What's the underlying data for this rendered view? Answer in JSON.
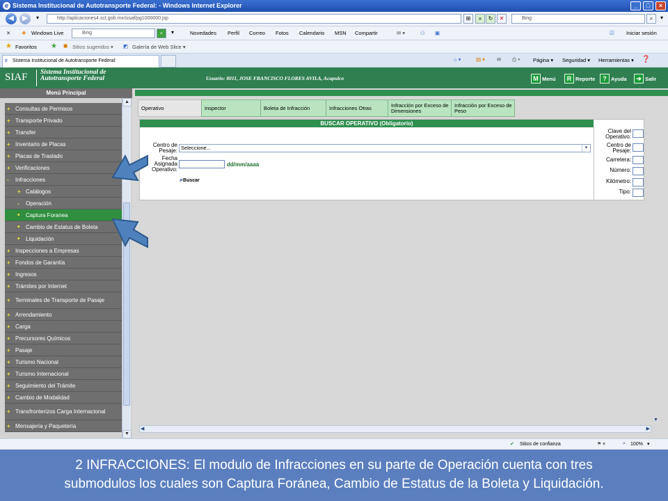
{
  "window": {
    "title": "Sistema Institucional de Autotransporte Federal: - Windows Internet Explorer",
    "controls": [
      "_",
      "□",
      "×"
    ]
  },
  "address": {
    "url": "http://aplicaciones4.sct.gob.mx/sisaf/pg1000000.jsp",
    "search_placeholder": "Bing"
  },
  "menubar": {
    "windows_live": "Windows Live",
    "search_placeholder": "Bing",
    "items": [
      "Novedades",
      "Perfil",
      "Correo",
      "Fotos",
      "Calendario",
      "MSN",
      "Compartir"
    ],
    "signin": "Iniciar sesión"
  },
  "favorites": {
    "favoritos": "Favoritos",
    "sitios": "Sitios sugeridos ▾",
    "galeria": "Galería de Web Slice ▾"
  },
  "tab": {
    "title": "Sistema Institucional de Autotransporte Federal:"
  },
  "commandbar": {
    "pagina": "Página ▾",
    "seguridad": "Seguridad ▾",
    "herramientas": "Herramientas ▾"
  },
  "app": {
    "logo": "SIAF",
    "name_line1": "Sistema Institucional de",
    "name_line2": "Autotransporte Federal",
    "user": "Usuario: 8011, JOSE FRANCISCO FLORES AVILA, Acapulco",
    "menu_btn": "Menú",
    "report_btn": "Reporte",
    "help_btn": "Ayuda",
    "exit_btn": "Salir"
  },
  "sidebar": {
    "title": "Menú Principal",
    "items": [
      {
        "mark": "+",
        "label": "Consultas de Permisos",
        "level": 0
      },
      {
        "mark": "+",
        "label": "Transporte Privado",
        "level": 0
      },
      {
        "mark": "+",
        "label": "Transfer",
        "level": 0
      },
      {
        "mark": "+",
        "label": "Inventario de Placas",
        "level": 0
      },
      {
        "mark": "+",
        "label": "Placas de Traslado",
        "level": 0
      },
      {
        "mark": "+",
        "label": "Verificaciones",
        "level": 0
      },
      {
        "mark": "-",
        "label": "Infracciones",
        "level": 0
      },
      {
        "mark": "+",
        "label": "Catálogos",
        "level": 1
      },
      {
        "mark": "-",
        "label": "Operación",
        "level": 1
      },
      {
        "mark": "•",
        "label": "Captura Foranea",
        "level": 1
      },
      {
        "mark": "•",
        "label": "Cambio de Estatus de Boleta",
        "level": 1
      },
      {
        "mark": "•",
        "label": "Liquidación",
        "level": 1
      },
      {
        "mark": "+",
        "label": "Inspecciones a Empresas",
        "level": 0
      },
      {
        "mark": "+",
        "label": "Fondos de Garantía",
        "level": 0
      },
      {
        "mark": "+",
        "label": "Ingresos",
        "level": 0
      },
      {
        "mark": "+",
        "label": "Trámites por Internet",
        "level": 0
      },
      {
        "mark": "+",
        "label": "Terminales de Transporte de Pasaje",
        "level": 0
      },
      {
        "mark": "+",
        "label": "Arrendamiento",
        "level": 0
      },
      {
        "mark": "+",
        "label": "Carga",
        "level": 0
      },
      {
        "mark": "+",
        "label": "Precursores Químicos",
        "level": 0
      },
      {
        "mark": "+",
        "label": "Pasaje",
        "level": 0
      },
      {
        "mark": "+",
        "label": "Turismo Nacional",
        "level": 0
      },
      {
        "mark": "+",
        "label": "Turismo Internacional",
        "level": 0
      },
      {
        "mark": "+",
        "label": "Seguimiento del Trámite",
        "level": 0
      },
      {
        "mark": "+",
        "label": "Cambio de Modalidad",
        "level": 0
      },
      {
        "mark": "+",
        "label": "Transfronterizos Carga Internacional",
        "level": 0
      },
      {
        "mark": "+",
        "label": "Mensajería y Paquetería",
        "level": 0
      }
    ]
  },
  "tabs": [
    "Operativo",
    "Inspector",
    "Boleta de Infracción",
    "Infracciones Otras",
    "Infracción por Exceso de Dimensiones",
    "Infracción por Exceso de Peso"
  ],
  "search": {
    "header": "BUSCAR OPERATIVO (Obligatorio)",
    "centro_label": "Centro de Pesaje:",
    "centro_value": "Seleccione...",
    "fecha_label": "Fecha Asignada Operativo:",
    "date_hint": "dd/mm/aaaa",
    "buscar": "Buscar",
    "right_labels": [
      "Clave del Operativo:",
      "Centro de Pesaje:",
      "Carretera:",
      "Número:",
      "Kilómetro:",
      "Tipo:"
    ]
  },
  "status": {
    "zone": "Sitios de confianza",
    "zoom": "100%"
  },
  "caption": {
    "line1": "2  INFRACCIONES: El modulo de Infracciones en su parte de Operación cuenta con tres",
    "line2": "submodulos los cuales son Captura Foránea, Cambio de Estatus de la Boleta y Liquidación."
  },
  "colors": {
    "green": "#2f8f4f",
    "caption_bg": "#5b7fbe",
    "sidebar_item": "#6f6f6f",
    "tab_green": "#b9e4bf"
  }
}
